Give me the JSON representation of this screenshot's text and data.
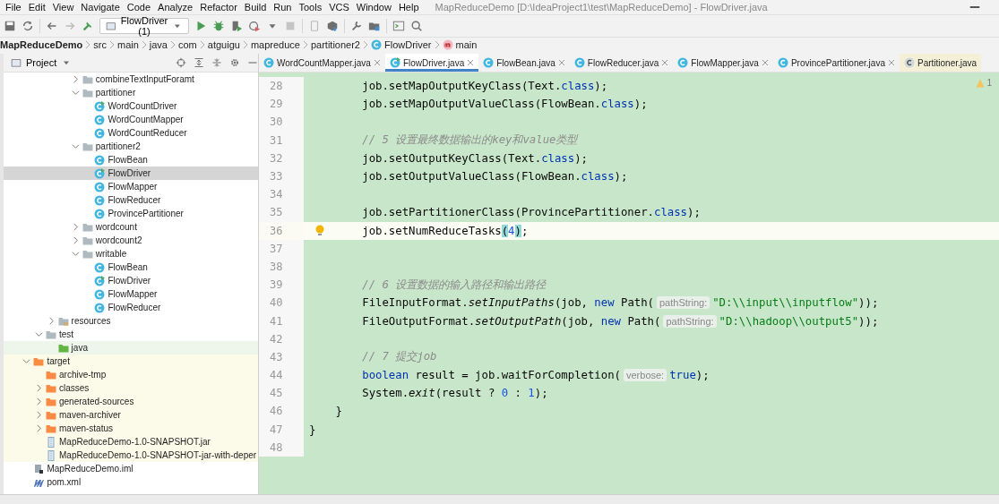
{
  "menu": {
    "items": [
      "File",
      "Edit",
      "View",
      "Navigate",
      "Code",
      "Analyze",
      "Refactor",
      "Build",
      "Run",
      "Tools",
      "VCS",
      "Window",
      "Help"
    ],
    "title": "MapReduceDemo [D:\\IdeaProject1\\test\\MapReduceDemo] - FlowDriver.java"
  },
  "toolbar": {
    "run_config": "FlowDriver (1)"
  },
  "breadcrumbs": [
    {
      "label": "MapReduceDemo",
      "kind": "project"
    },
    {
      "label": "src",
      "kind": "plain"
    },
    {
      "label": "main",
      "kind": "plain"
    },
    {
      "label": "java",
      "kind": "plain"
    },
    {
      "label": "com",
      "kind": "plain"
    },
    {
      "label": "atguigu",
      "kind": "plain"
    },
    {
      "label": "mapreduce",
      "kind": "plain"
    },
    {
      "label": "partitioner2",
      "kind": "plain"
    },
    {
      "label": "FlowDriver",
      "kind": "class"
    },
    {
      "label": "main",
      "kind": "method"
    }
  ],
  "project_panel": {
    "title": "Project",
    "tree": [
      {
        "children": [
          {
            "children": [
              {
                "children": [
                  {
                    "children": [
                      {
                        "label": "combineTextInputForamt",
                        "kind": "folder",
                        "expanded": false,
                        "selected": false
                      },
                      {
                        "label": "partitioner",
                        "kind": "folder",
                        "expanded": true,
                        "selected": false,
                        "children": [
                          {
                            "label": "WordCountDriver",
                            "kind": "main-class",
                            "selected": false
                          },
                          {
                            "label": "WordCountMapper",
                            "kind": "class",
                            "selected": false
                          },
                          {
                            "label": "WordCountReducer",
                            "kind": "class",
                            "selected": false
                          }
                        ]
                      },
                      {
                        "label": "partitioner2",
                        "kind": "folder",
                        "expanded": true,
                        "selected": false,
                        "children": [
                          {
                            "label": "FlowBean",
                            "kind": "class",
                            "selected": false
                          },
                          {
                            "label": "FlowDriver",
                            "kind": "main-class",
                            "selected": true
                          },
                          {
                            "label": "FlowMapper",
                            "kind": "class",
                            "selected": false
                          },
                          {
                            "label": "FlowReducer",
                            "kind": "class",
                            "selected": false
                          },
                          {
                            "label": "ProvincePartitioner",
                            "kind": "class",
                            "selected": false
                          }
                        ]
                      },
                      {
                        "label": "wordcount",
                        "kind": "folder",
                        "expanded": false,
                        "selected": false
                      },
                      {
                        "label": "wordcount2",
                        "kind": "folder",
                        "expanded": false,
                        "selected": false
                      },
                      {
                        "label": "writable",
                        "kind": "folder",
                        "expanded": true,
                        "selected": false,
                        "children": [
                          {
                            "label": "FlowBean",
                            "kind": "class",
                            "selected": false
                          },
                          {
                            "label": "FlowDriver",
                            "kind": "main-class",
                            "selected": false
                          },
                          {
                            "label": "FlowMapper",
                            "kind": "class",
                            "selected": false
                          },
                          {
                            "label": "FlowReducer",
                            "kind": "class",
                            "selected": false
                          }
                        ]
                      }
                    ]
                  }
                ]
              },
              {
                "label": "resources",
                "kind": "resources-folder",
                "expanded": false,
                "selected": false
              }
            ]
          },
          {
            "label": "test",
            "kind": "folder",
            "expanded": true,
            "selected": false,
            "children": [
              {
                "label": "java",
                "kind": "source-folder",
                "selected": false
              }
            ]
          }
        ]
      },
      {
        "label": "target",
        "kind": "excluded-folder",
        "expanded": true,
        "selected": false,
        "children": [
          {
            "label": "archive-tmp",
            "kind": "excluded-folder",
            "selected": false
          },
          {
            "label": "classes",
            "kind": "excluded-folder",
            "expanded": false,
            "selected": false
          },
          {
            "label": "generated-sources",
            "kind": "excluded-folder",
            "expanded": false,
            "selected": false
          },
          {
            "label": "maven-archiver",
            "kind": "excluded-folder",
            "expanded": false,
            "selected": false
          },
          {
            "label": "maven-status",
            "kind": "excluded-folder",
            "expanded": false,
            "selected": false
          },
          {
            "label": "MapReduceDemo-1.0-SNAPSHOT.jar",
            "kind": "excluded-jar",
            "selected": false
          },
          {
            "label": "MapReduceDemo-1.0-SNAPSHOT-jar-with-deper",
            "kind": "excluded-jar",
            "selected": false
          }
        ]
      },
      {
        "label": "MapReduceDemo.iml",
        "kind": "module-file",
        "selected": false
      },
      {
        "label": "pom.xml",
        "kind": "maven-file",
        "selected": false
      }
    ]
  },
  "tabs": [
    {
      "label": "WordCountMapper.java",
      "kind": "class",
      "selected": false,
      "closable": true
    },
    {
      "label": "FlowDriver.java",
      "kind": "main-class",
      "selected": true,
      "closable": true
    },
    {
      "label": "FlowBean.java",
      "kind": "class",
      "selected": false,
      "closable": true
    },
    {
      "label": "FlowReducer.java",
      "kind": "class",
      "selected": false,
      "closable": true
    },
    {
      "label": "FlowMapper.java",
      "kind": "class",
      "selected": false,
      "closable": true
    },
    {
      "label": "ProvincePartitioner.java",
      "kind": "class",
      "selected": false,
      "closable": true
    },
    {
      "label": "Partitioner.java",
      "kind": "interface",
      "selected": false,
      "closable": false
    }
  ],
  "editor": {
    "warnings": "1",
    "lines": [
      {
        "number": "28",
        "tokens": [
          {
            "kind": "plain",
            "text": "        job.setMapOutputKeyClass(Text."
          },
          {
            "kind": "keyword",
            "text": "class"
          },
          {
            "kind": "plain",
            "text": ");"
          }
        ]
      },
      {
        "number": "29",
        "tokens": [
          {
            "kind": "plain",
            "text": "        job.setMapOutputValueClass(FlowBean."
          },
          {
            "kind": "keyword",
            "text": "class"
          },
          {
            "kind": "plain",
            "text": ");"
          }
        ]
      },
      {
        "number": "30"
      },
      {
        "number": "31",
        "tokens": [
          {
            "kind": "comment",
            "text": "        // 5 设置最终数据输出的key和value类型"
          }
        ]
      },
      {
        "number": "32",
        "tokens": [
          {
            "kind": "plain",
            "text": "        job.setOutputKeyClass(Text."
          },
          {
            "kind": "keyword",
            "text": "class"
          },
          {
            "kind": "plain",
            "text": ");"
          }
        ]
      },
      {
        "number": "33",
        "tokens": [
          {
            "kind": "plain",
            "text": "        job.setOutputValueClass(FlowBean."
          },
          {
            "kind": "keyword",
            "text": "class"
          },
          {
            "kind": "plain",
            "text": ");"
          }
        ]
      },
      {
        "number": "34"
      },
      {
        "number": "35",
        "tokens": [
          {
            "kind": "plain",
            "text": "        job.setPartitionerClass(ProvincePartitioner."
          },
          {
            "kind": "keyword",
            "text": "class"
          },
          {
            "kind": "plain",
            "text": ");"
          }
        ]
      },
      {
        "number": "36",
        "current": true,
        "bulb": true,
        "tokens": [
          {
            "kind": "plain",
            "text": "        job.setNumReduceTasks"
          },
          {
            "kind": "brace-match",
            "text": "("
          },
          {
            "kind": "number",
            "text": "4"
          },
          {
            "kind": "brace-match",
            "text": ")"
          },
          {
            "kind": "plain",
            "text": ";"
          }
        ]
      },
      {
        "number": "37"
      },
      {
        "number": "38"
      },
      {
        "number": "39",
        "tokens": [
          {
            "kind": "comment",
            "text": "        // 6 设置数据的输入路径和输出路径"
          }
        ]
      },
      {
        "number": "40",
        "tokens": [
          {
            "kind": "plain",
            "text": "        FileInputFormat."
          },
          {
            "kind": "static",
            "text": "setInputPaths"
          },
          {
            "kind": "plain",
            "text": "(job, "
          },
          {
            "kind": "keyword",
            "text": "new"
          },
          {
            "kind": "plain",
            "text": " Path("
          },
          {
            "kind": "hint",
            "text": "pathString:"
          },
          {
            "kind": "string",
            "text": "\"D:\\\\input\\\\inputflow\""
          },
          {
            "kind": "plain",
            "text": "));"
          }
        ]
      },
      {
        "number": "41",
        "tokens": [
          {
            "kind": "plain",
            "text": "        FileOutputFormat."
          },
          {
            "kind": "static",
            "text": "setOutputPath"
          },
          {
            "kind": "plain",
            "text": "(job, "
          },
          {
            "kind": "keyword",
            "text": "new"
          },
          {
            "kind": "plain",
            "text": " Path("
          },
          {
            "kind": "hint",
            "text": "pathString:"
          },
          {
            "kind": "string",
            "text": "\"D:\\\\hadoop\\\\output5\""
          },
          {
            "kind": "plain",
            "text": "));"
          }
        ]
      },
      {
        "number": "42"
      },
      {
        "number": "43",
        "tokens": [
          {
            "kind": "comment",
            "text": "        // 7 提交job"
          }
        ]
      },
      {
        "number": "44",
        "tokens": [
          {
            "kind": "keyword",
            "text": "        boolean"
          },
          {
            "kind": "plain",
            "text": " result = job.waitForCompletion("
          },
          {
            "kind": "hint",
            "text": "verbose:"
          },
          {
            "kind": "keyword",
            "text": "true"
          },
          {
            "kind": "plain",
            "text": ");"
          }
        ]
      },
      {
        "number": "45",
        "tokens": [
          {
            "kind": "plain",
            "text": "        System."
          },
          {
            "kind": "static",
            "text": "exit"
          },
          {
            "kind": "plain",
            "text": "(result ? "
          },
          {
            "kind": "number",
            "text": "0"
          },
          {
            "kind": "plain",
            "text": " : "
          },
          {
            "kind": "number",
            "text": "1"
          },
          {
            "kind": "plain",
            "text": ");"
          }
        ]
      },
      {
        "number": "46",
        "tokens": [
          {
            "kind": "plain",
            "text": "    }"
          }
        ]
      },
      {
        "number": "47",
        "tokens": [
          {
            "kind": "plain",
            "text": "}"
          }
        ]
      },
      {
        "number": "48"
      }
    ]
  }
}
